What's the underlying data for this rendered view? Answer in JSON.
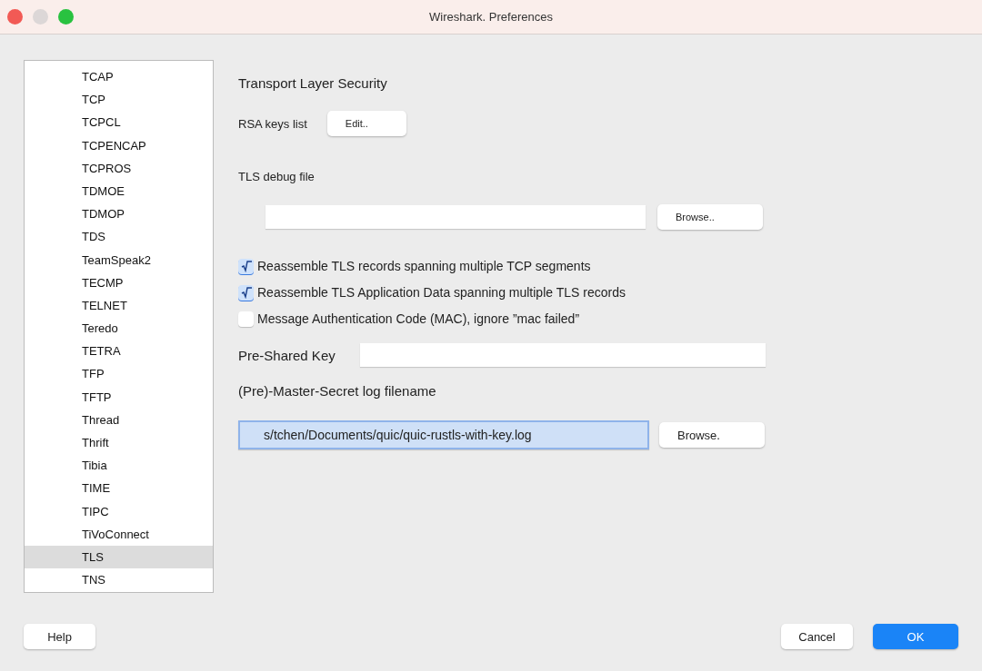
{
  "window": {
    "title": "Wireshark. Preferences"
  },
  "sidebar": {
    "items": [
      {
        "label": "TCAP",
        "selected": false
      },
      {
        "label": "TCP",
        "selected": false
      },
      {
        "label": "TCPCL",
        "selected": false
      },
      {
        "label": "TCPENCAP",
        "selected": false
      },
      {
        "label": "TCPROS",
        "selected": false
      },
      {
        "label": "TDMOE",
        "selected": false
      },
      {
        "label": "TDMOP",
        "selected": false
      },
      {
        "label": "TDS",
        "selected": false
      },
      {
        "label": "TeamSpeak2",
        "selected": false
      },
      {
        "label": "TECMP",
        "selected": false
      },
      {
        "label": "TELNET",
        "selected": false
      },
      {
        "label": "Teredo",
        "selected": false
      },
      {
        "label": "TETRA",
        "selected": false
      },
      {
        "label": "TFP",
        "selected": false
      },
      {
        "label": "TFTP",
        "selected": false
      },
      {
        "label": "Thread",
        "selected": false
      },
      {
        "label": "Thrift",
        "selected": false
      },
      {
        "label": "Tibia",
        "selected": false
      },
      {
        "label": "TIME",
        "selected": false
      },
      {
        "label": "TIPC",
        "selected": false
      },
      {
        "label": "TiVoConnect",
        "selected": false
      },
      {
        "label": "TLS",
        "selected": true
      },
      {
        "label": "TNS",
        "selected": false
      }
    ]
  },
  "panel": {
    "title": "Transport Layer Security",
    "rsa_keys": {
      "label": "RSA keys list",
      "button": "Edit.."
    },
    "debug_file": {
      "label": "TLS debug file",
      "button": "Browse.."
    },
    "options": [
      {
        "label": "Reassemble TLS records spanning multiple TCP segments",
        "checked": true
      },
      {
        "label": "Reassemble TLS Application Data spanning multiple TLS records",
        "checked": true
      },
      {
        "label": "Message Authentication Code (MAC), ignore ”mac failed”",
        "checked": false
      }
    ],
    "psk": {
      "label": "Pre-Shared Key"
    },
    "keylog": {
      "label": "(Pre)-Master-Secret log filename",
      "value": "s/tchen/Documents/quic/quic-rustls-with-key.log",
      "button": "Browse."
    }
  },
  "buttons": {
    "help": "Help",
    "cancel": "Cancel",
    "ok": "OK"
  }
}
